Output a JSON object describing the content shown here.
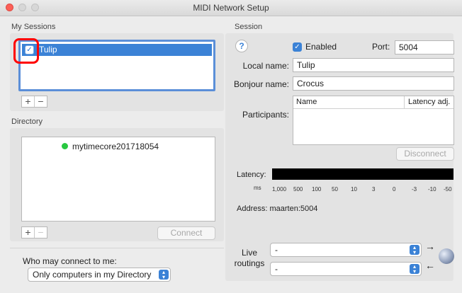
{
  "window": {
    "title": "MIDI Network Setup"
  },
  "sessions": {
    "section_title": "My Sessions",
    "items": [
      {
        "name": "Tulip",
        "checked": true
      }
    ],
    "add_label": "+",
    "remove_label": "−"
  },
  "directory": {
    "section_title": "Directory",
    "items": [
      {
        "name": "mytimecore201718054",
        "status_color": "#28c840"
      }
    ],
    "add_label": "+",
    "remove_label": "−",
    "connect_label": "Connect"
  },
  "who_may_connect": {
    "label": "Who may connect to me:",
    "selected": "Only computers in my Directory"
  },
  "session": {
    "section_title": "Session",
    "help_label": "?",
    "enabled_label": "Enabled",
    "enabled": true,
    "port_label": "Port:",
    "port_value": "5004",
    "local_name_label": "Local name:",
    "local_name_value": "Tulip",
    "bonjour_name_label": "Bonjour name:",
    "bonjour_name_value": "Crocus",
    "participants_label": "Participants:",
    "participants_columns": [
      "Name",
      "Latency adj."
    ],
    "disconnect_label": "Disconnect",
    "latency_label": "Latency:",
    "latency_unit": "ms",
    "latency_ticks": [
      "1,000",
      "500",
      "100",
      "50",
      "10",
      "3",
      "0",
      "-3",
      "-10",
      "-50"
    ],
    "address_label": "Address:",
    "address_value": "maarten:5004"
  },
  "live_routings": {
    "label_line1": "Live",
    "label_line2": "routings",
    "out_value": "-",
    "in_value": "-",
    "out_arrow": "→",
    "in_arrow": "←"
  },
  "colors": {
    "accent": "#3b82d6",
    "annotation": "#ff0000",
    "online": "#28c840"
  }
}
